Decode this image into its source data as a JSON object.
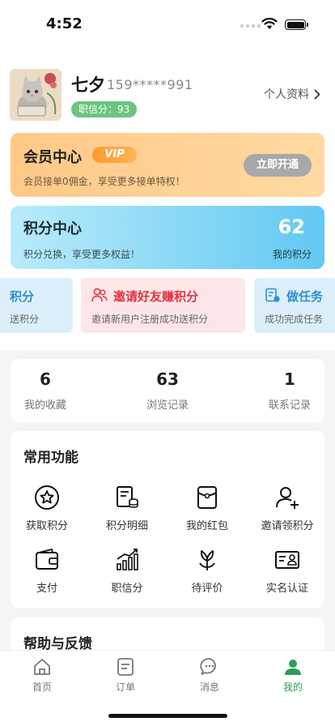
{
  "status_bar": {
    "time": "4:52"
  },
  "profile": {
    "name": "七夕",
    "phone": "159*****991",
    "credit_badge": "职信分：93",
    "profile_link": "个人资料"
  },
  "vip_card": {
    "title": "会员中心",
    "tag": "VIP",
    "description": "会员接单0佣金，享受更多接单特权！",
    "button": "立即开通"
  },
  "points_card": {
    "title": "积分中心",
    "description": "积分兑换，享受更多权益！",
    "value": "62",
    "value_label": "我的积分"
  },
  "promos": [
    {
      "title": "积分",
      "description": "送积分"
    },
    {
      "title": "邀请好友赚积分",
      "description": "邀请新用户注册成功送积分"
    },
    {
      "title": "做任务",
      "description": "成功完成任务"
    }
  ],
  "stats": [
    {
      "value": "6",
      "label": "我的收藏"
    },
    {
      "value": "63",
      "label": "浏览记录"
    },
    {
      "value": "1",
      "label": "联系记录"
    }
  ],
  "functions": {
    "title": "常用功能",
    "items": [
      {
        "label": "获取积分",
        "icon": "star-circle-icon"
      },
      {
        "label": "积分明细",
        "icon": "ledger-icon"
      },
      {
        "label": "我的红包",
        "icon": "red-packet-icon"
      },
      {
        "label": "邀请领积分",
        "icon": "add-user-icon"
      },
      {
        "label": "支付",
        "icon": "wallet-icon"
      },
      {
        "label": "职信分",
        "icon": "chart-icon"
      },
      {
        "label": "待评价",
        "icon": "flower-icon"
      },
      {
        "label": "实名认证",
        "icon": "id-card-icon"
      }
    ]
  },
  "help": {
    "title": "帮助与反馈"
  },
  "tabs": [
    {
      "label": "首页",
      "icon": "home-icon"
    },
    {
      "label": "订单",
      "icon": "order-icon"
    },
    {
      "label": "消息",
      "icon": "message-icon"
    },
    {
      "label": "我的",
      "icon": "user-icon",
      "active": true
    }
  ],
  "colors": {
    "accent_green": "#2e9e55",
    "credit_green": "#6cc47f",
    "vip_orange": "#ffc987",
    "points_blue": "#62c8f2",
    "promo_red": "#e5323e",
    "promo_blue": "#2f8fd6"
  }
}
